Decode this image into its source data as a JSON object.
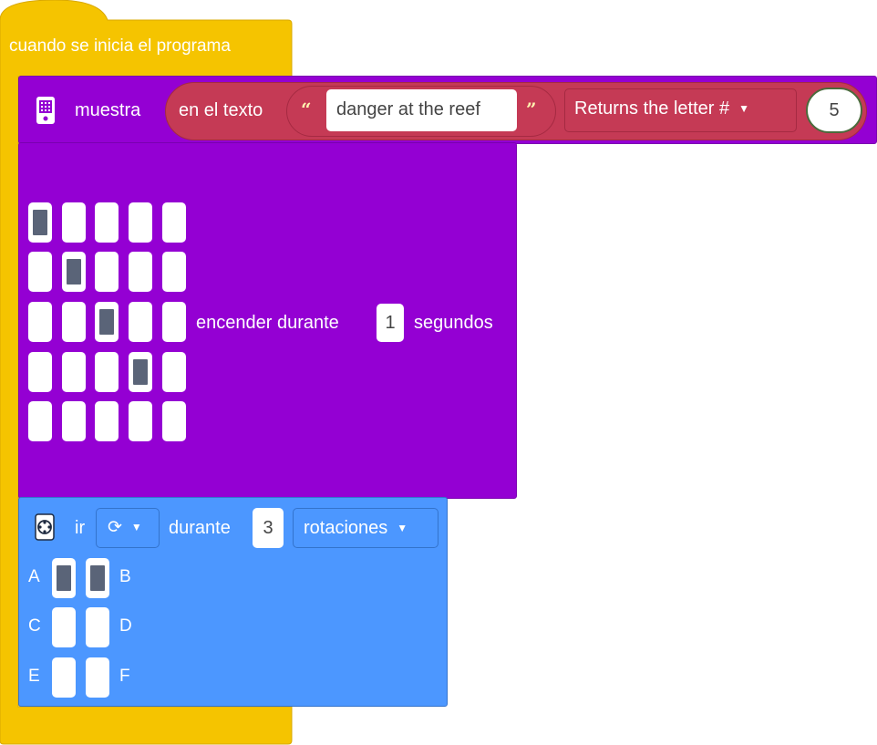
{
  "hat": {
    "label": "cuando se inicia el programa",
    "color": "#f5c400"
  },
  "show_text": {
    "label": "muestra",
    "icon": "microbit-board-icon",
    "color": "#9400d3",
    "reporter": {
      "label": "en el texto",
      "open_quote": "“",
      "close_quote": "”",
      "text_value": "danger at the reef",
      "mode": "Returns the letter #",
      "number": "5",
      "color": "#c53a55"
    }
  },
  "matrix": {
    "rows": [
      [
        1,
        0,
        0,
        0,
        0
      ],
      [
        0,
        1,
        0,
        0,
        0
      ],
      [
        0,
        0,
        1,
        0,
        0
      ],
      [
        0,
        0,
        0,
        1,
        0
      ],
      [
        0,
        0,
        0,
        0,
        0
      ]
    ],
    "label_before": "encender durante",
    "duration": "1",
    "label_after": "segundos"
  },
  "motor": {
    "icon": "motor-icon",
    "go_label": "ir",
    "direction_icon": "rotate-clockwise-icon",
    "for_label": "durante",
    "amount": "3",
    "unit": "rotaciones",
    "color": "#4c97ff",
    "ports": [
      {
        "left": "A",
        "right": "B",
        "left_on": true,
        "right_on": true
      },
      {
        "left": "C",
        "right": "D",
        "left_on": false,
        "right_on": false
      },
      {
        "left": "E",
        "right": "F",
        "left_on": false,
        "right_on": false
      }
    ]
  }
}
